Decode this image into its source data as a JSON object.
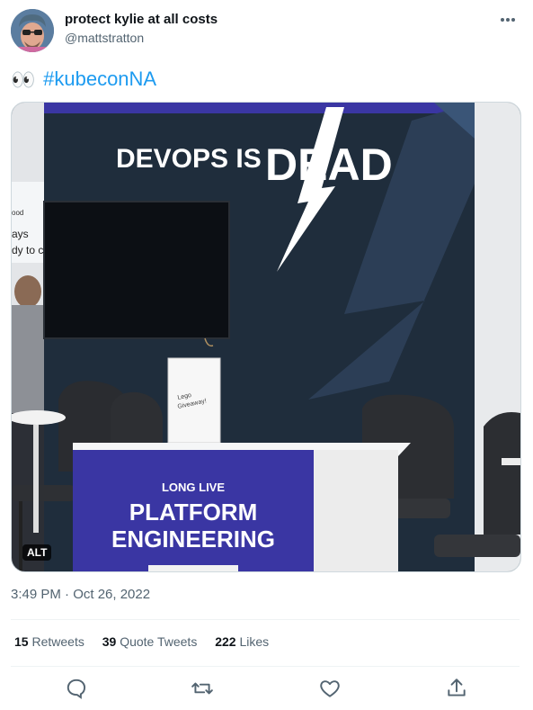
{
  "author": {
    "name": "protect kylie at all costs",
    "handle": "@mattstratton"
  },
  "tweet": {
    "emoji": "👀",
    "hashtag": "#kubeconNA"
  },
  "media": {
    "sign_headline": "DEVOPS IS DEAD",
    "desk_small": "LONG LIVE",
    "desk_line1": "PLATFORM",
    "desk_line2": "ENGINEERING",
    "alt_badge": "ALT",
    "card_text": "Lego Giveaway!"
  },
  "timestamp": "3:49 PM · Oct 26, 2022",
  "stats": {
    "retweets_count": "15",
    "retweets_label": "Retweets",
    "quotes_count": "39",
    "quotes_label": "Quote Tweets",
    "likes_count": "222",
    "likes_label": "Likes"
  },
  "icons": {
    "reply": "reply-icon",
    "retweet": "retweet-icon",
    "like": "heart-icon",
    "share": "share-icon",
    "more": "more-icon"
  },
  "colors": {
    "accent": "#1d9bf0",
    "text": "#0f1419",
    "muted": "#536471",
    "booth_blue": "#3a36a3"
  }
}
